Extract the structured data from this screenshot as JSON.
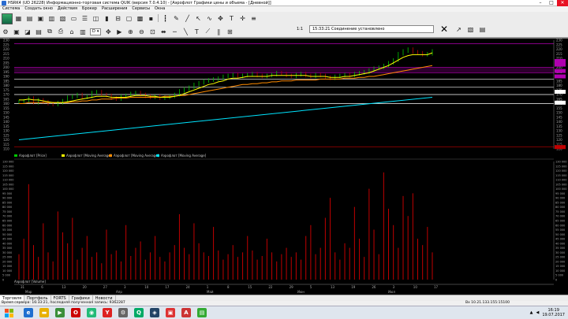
{
  "window": {
    "title": "HSRK4 (UD 26228) Информационно-торговая система QUIK (версия 7.0.4.10) - [Аэрофлот Графики цены и объема - [Дневной]]",
    "min": "–",
    "max": "□",
    "close": "✕"
  },
  "menu": [
    "Система",
    "Создать окно",
    "Действия",
    "Брокер",
    "Расширения",
    "Сервисы",
    "Окна"
  ],
  "toolbar": {
    "interval": "D",
    "ratio": "1:1",
    "connection_status": "15:33:21  Соединение установлено"
  },
  "price_legend": [
    {
      "label": "Аэрофлот [Price]",
      "color": "#00c800"
    },
    {
      "label": "Аэрофлот [Moving Average]",
      "color": "#ffff00"
    },
    {
      "label": "Аэрофлот [Moving Average]",
      "color": "#ff8c00"
    },
    {
      "label": "Аэрофлот [Moving Average]",
      "color": "#00e5ff"
    }
  ],
  "volume_legend": {
    "label": "Аэрофлот [Volume]",
    "color": "#c00000"
  },
  "price_axis": [
    "230",
    "225",
    "220",
    "215",
    "210",
    "205",
    "200",
    "195",
    "190",
    "185",
    "180",
    "175",
    "170",
    "165",
    "160",
    "155",
    "150",
    "145",
    "140",
    "135",
    "130",
    "125",
    "120",
    "115",
    "110"
  ],
  "volume_axis": [
    "130 000",
    "125 000",
    "120 000",
    "115 000",
    "110 000",
    "105 000",
    "100 000",
    "95 000",
    "90 000",
    "85 000",
    "80 000",
    "75 000",
    "70 000",
    "65 000",
    "60 000",
    "55 000",
    "50 000",
    "45 000",
    "40 000",
    "35 000",
    "30 000",
    "25 000",
    "20 000",
    "15 000",
    "10 000",
    "5 000",
    "0"
  ],
  "date_axis": [
    "31",
    "6",
    "13",
    "20",
    "27",
    "3",
    "10",
    "17",
    "24",
    "1",
    "8",
    "15",
    "22",
    "29",
    "5",
    "13",
    "19",
    "26",
    "3",
    "10",
    "17"
  ],
  "month_axis": [
    "Мар",
    "Апр",
    "Май",
    "Июн",
    "Июл"
  ],
  "chart_data": {
    "type": "line",
    "title": "Аэрофлот Графики цены и объема - [Дневной]",
    "price_ylim": [
      110,
      230
    ],
    "price": [
      162,
      163,
      166,
      161,
      164,
      162,
      160,
      159,
      161,
      163,
      167,
      168,
      170,
      167,
      168,
      172,
      173,
      170,
      169,
      166,
      165,
      168,
      169,
      171,
      172,
      170,
      168,
      167,
      168,
      166,
      167,
      168,
      170,
      174,
      176,
      178,
      181,
      183,
      185,
      186,
      187,
      188,
      190,
      191,
      192,
      190,
      191,
      192,
      193,
      191,
      190,
      191,
      192,
      194,
      193,
      191,
      190,
      192,
      193,
      191,
      190,
      192,
      191,
      189,
      188,
      190,
      191,
      192,
      191,
      193,
      194,
      195,
      197,
      199,
      200,
      202,
      205,
      208,
      215,
      218,
      220,
      217,
      216,
      214,
      215,
      218
    ],
    "ma_yellow": [
      164,
      164,
      165,
      164,
      164,
      163,
      162,
      161,
      161,
      161,
      162,
      163,
      164,
      165,
      166,
      167,
      168,
      168,
      168,
      167,
      167,
      167,
      167,
      168,
      169,
      169,
      169,
      168,
      168,
      167,
      167,
      167,
      168,
      169,
      171,
      173,
      175,
      177,
      179,
      181,
      182,
      184,
      185,
      187,
      188,
      188,
      189,
      190,
      190,
      190,
      190,
      190,
      191,
      191,
      191,
      191,
      191,
      191,
      191,
      191,
      190,
      190,
      190,
      190,
      189,
      189,
      189,
      190,
      190,
      191,
      192,
      193,
      194,
      196,
      198,
      200,
      202,
      205,
      208,
      211,
      213,
      214,
      214,
      214,
      214,
      216
    ],
    "ma_orange": [
      160,
      160,
      161,
      161,
      161,
      161,
      161,
      161,
      161,
      161,
      161,
      162,
      162,
      163,
      163,
      164,
      164,
      165,
      165,
      165,
      166,
      166,
      166,
      167,
      167,
      167,
      167,
      167,
      167,
      167,
      168,
      168,
      168,
      169,
      169,
      170,
      171,
      172,
      173,
      174,
      175,
      176,
      177,
      178,
      179,
      180,
      181,
      181,
      182,
      182,
      183,
      183,
      184,
      184,
      185,
      185,
      185,
      186,
      186,
      186,
      186,
      186,
      187,
      187,
      187,
      187,
      187,
      188,
      188,
      188,
      189,
      189,
      190,
      190,
      191,
      192,
      193,
      194,
      195,
      196,
      197,
      198,
      199,
      200,
      201,
      202
    ],
    "ma_cyan_start": 120,
    "ma_cyan_end": 167,
    "volume": [
      28000,
      45000,
      105000,
      38000,
      25000,
      62000,
      30000,
      20000,
      75000,
      52000,
      40000,
      68000,
      22000,
      35000,
      48000,
      25000,
      30000,
      18000,
      55000,
      28000,
      32000,
      20000,
      60000,
      26000,
      35000,
      42000,
      22000,
      30000,
      48000,
      25000,
      20000,
      30000,
      38000,
      72000,
      35000,
      28000,
      62000,
      40000,
      30000,
      26000,
      58000,
      32000,
      22000,
      28000,
      38000,
      25000,
      30000,
      48000,
      32000,
      22000,
      26000,
      45000,
      30000,
      20000,
      28000,
      35000,
      25000,
      30000,
      22000,
      48000,
      60000,
      28000,
      35000,
      68000,
      90000,
      30000,
      22000,
      40000,
      35000,
      80000,
      45000,
      25000,
      100000,
      55000,
      28000,
      118000,
      78000,
      60000,
      35000,
      92000,
      70000,
      95000,
      45000,
      38000,
      58000,
      30000
    ],
    "volume_ylim": [
      0,
      130000
    ]
  },
  "bottom_tabs": [
    "Торговля",
    "Портфель",
    "FORTS",
    "Графики",
    "Новости"
  ],
  "status": {
    "left": "Время сервера: 16:33:21, последняя полученная запись: 9362287",
    "right": "Вх 10.21.133.155:15100"
  },
  "tray": {
    "time": "16:19",
    "date": "19.07.2017"
  }
}
